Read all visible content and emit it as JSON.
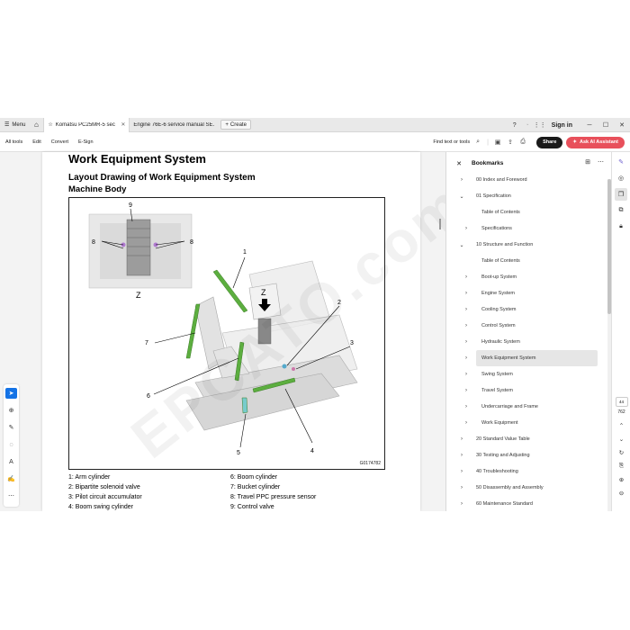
{
  "tabbar": {
    "menu_label": "Menu",
    "tabs": [
      {
        "title": "Komatsu PC25MR-5 sec..."
      },
      {
        "title": "Engine 76E-6 service manual SE..."
      }
    ],
    "create_label": "Create",
    "signin_label": "Sign in"
  },
  "toolbar": {
    "items": [
      "All tools",
      "Edit",
      "Convert",
      "E-Sign"
    ],
    "find_label": "Find text or tools",
    "share_label": "Share",
    "ai_label": "Ask AI Assistant"
  },
  "document": {
    "title": "Work Equipment System",
    "subtitle": "Layout Drawing of Work Equipment System",
    "section": "Machine Body",
    "figure_code": "G0174782",
    "figure_labels": {
      "z1": "Z",
      "z2": "Z",
      "n1": "1",
      "n2": "2",
      "n3": "3",
      "n4": "4",
      "n5": "5",
      "n6": "6",
      "n7": "7",
      "n8a": "8",
      "n8b": "8",
      "n9": "9"
    },
    "legend_left": [
      "1: Arm cylinder",
      "2: Bipartite solenoid valve",
      "3: Pilot circuit accumulator",
      "4: Boom swing cylinder"
    ],
    "legend_right": [
      "6: Boom cylinder",
      "7: Bucket cylinder",
      "8: Travel PPC pressure sensor",
      "9: Control valve"
    ],
    "watermark": "EPCATO.com"
  },
  "bookmarks": {
    "title": "Bookmarks",
    "items": [
      {
        "label": "00 Index and Foreword",
        "level": 0,
        "chevron": "right"
      },
      {
        "label": "01 Specification",
        "level": 0,
        "chevron": "down"
      },
      {
        "label": "Table of Contents",
        "level": 1,
        "chevron": ""
      },
      {
        "label": "Specifications",
        "level": 1,
        "chevron": "right"
      },
      {
        "label": "10 Structure and Function",
        "level": 0,
        "chevron": "down"
      },
      {
        "label": "Table of Contents",
        "level": 1,
        "chevron": ""
      },
      {
        "label": "Boot-up System",
        "level": 1,
        "chevron": "right"
      },
      {
        "label": "Engine System",
        "level": 1,
        "chevron": "right"
      },
      {
        "label": "Cooling System",
        "level": 1,
        "chevron": "right"
      },
      {
        "label": "Control System",
        "level": 1,
        "chevron": "right"
      },
      {
        "label": "Hydraulic System",
        "level": 1,
        "chevron": "right"
      },
      {
        "label": "Work Equipment System",
        "level": 1,
        "chevron": "right",
        "selected": true
      },
      {
        "label": "Swing System",
        "level": 1,
        "chevron": "right"
      },
      {
        "label": "Travel System",
        "level": 1,
        "chevron": "right"
      },
      {
        "label": "Undercarriage and Frame",
        "level": 1,
        "chevron": "right"
      },
      {
        "label": "Work Equipment",
        "level": 1,
        "chevron": "right"
      },
      {
        "label": "20 Standard Value Table",
        "level": 0,
        "chevron": "right"
      },
      {
        "label": "30 Testing and Adjusting",
        "level": 0,
        "chevron": "right"
      },
      {
        "label": "40 Troubleshooting",
        "level": 0,
        "chevron": "right"
      },
      {
        "label": "50 Disassembly and Assembly",
        "level": 0,
        "chevron": "right"
      },
      {
        "label": "60 Maintenance Standard",
        "level": 0,
        "chevron": "right"
      }
    ]
  },
  "right_rail": {
    "page_number": "762",
    "page_box_label": "44"
  },
  "colors": {
    "share_bg": "#1a1a1a",
    "ai_bg": "#e8505b",
    "selected_tool": "#1473e6",
    "cylinder_green": "#5cae3f"
  }
}
